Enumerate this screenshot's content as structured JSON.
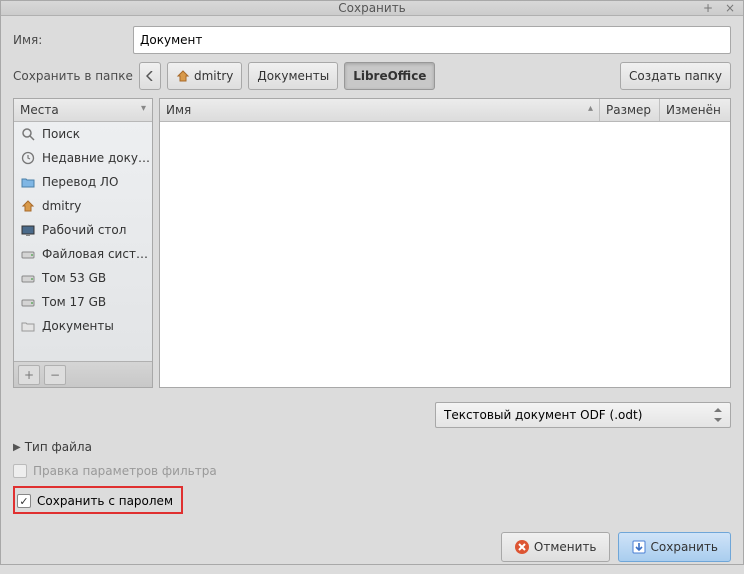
{
  "window": {
    "title": "Сохранить"
  },
  "name": {
    "label": "Имя:",
    "value": "Документ"
  },
  "saveInFolder": {
    "label": "Сохранить в папке",
    "path": [
      "dmitry",
      "Документы",
      "LibreOffice"
    ],
    "activeIndex": 2,
    "createFolder": "Создать папку"
  },
  "places": {
    "header": "Места",
    "items": [
      {
        "icon": "search",
        "label": "Поиск"
      },
      {
        "icon": "recent",
        "label": "Недавние доку…"
      },
      {
        "icon": "folder",
        "label": "Перевод ЛО"
      },
      {
        "icon": "home",
        "label": "dmitry"
      },
      {
        "icon": "desktop",
        "label": "Рабочий стол"
      },
      {
        "icon": "drive",
        "label": "Файловая сист…"
      },
      {
        "icon": "drive",
        "label": "Том 53 GB"
      },
      {
        "icon": "drive",
        "label": "Том 17 GB"
      },
      {
        "icon": "folder-docs",
        "label": "Документы"
      }
    ]
  },
  "fileList": {
    "columns": {
      "name": "Имя",
      "size": "Размер",
      "modified": "Изменён"
    }
  },
  "fileType": {
    "selected": "Текстовый документ ODF (.odt)",
    "expanderLabel": "Тип файла"
  },
  "options": {
    "filterSettings": {
      "label": "Правка параметров фильтра",
      "checked": false,
      "enabled": false
    },
    "saveWithPassword": {
      "label": "Сохранить с паролем",
      "checked": true,
      "enabled": true
    }
  },
  "buttons": {
    "cancel": "Отменить",
    "save": "Сохранить"
  }
}
